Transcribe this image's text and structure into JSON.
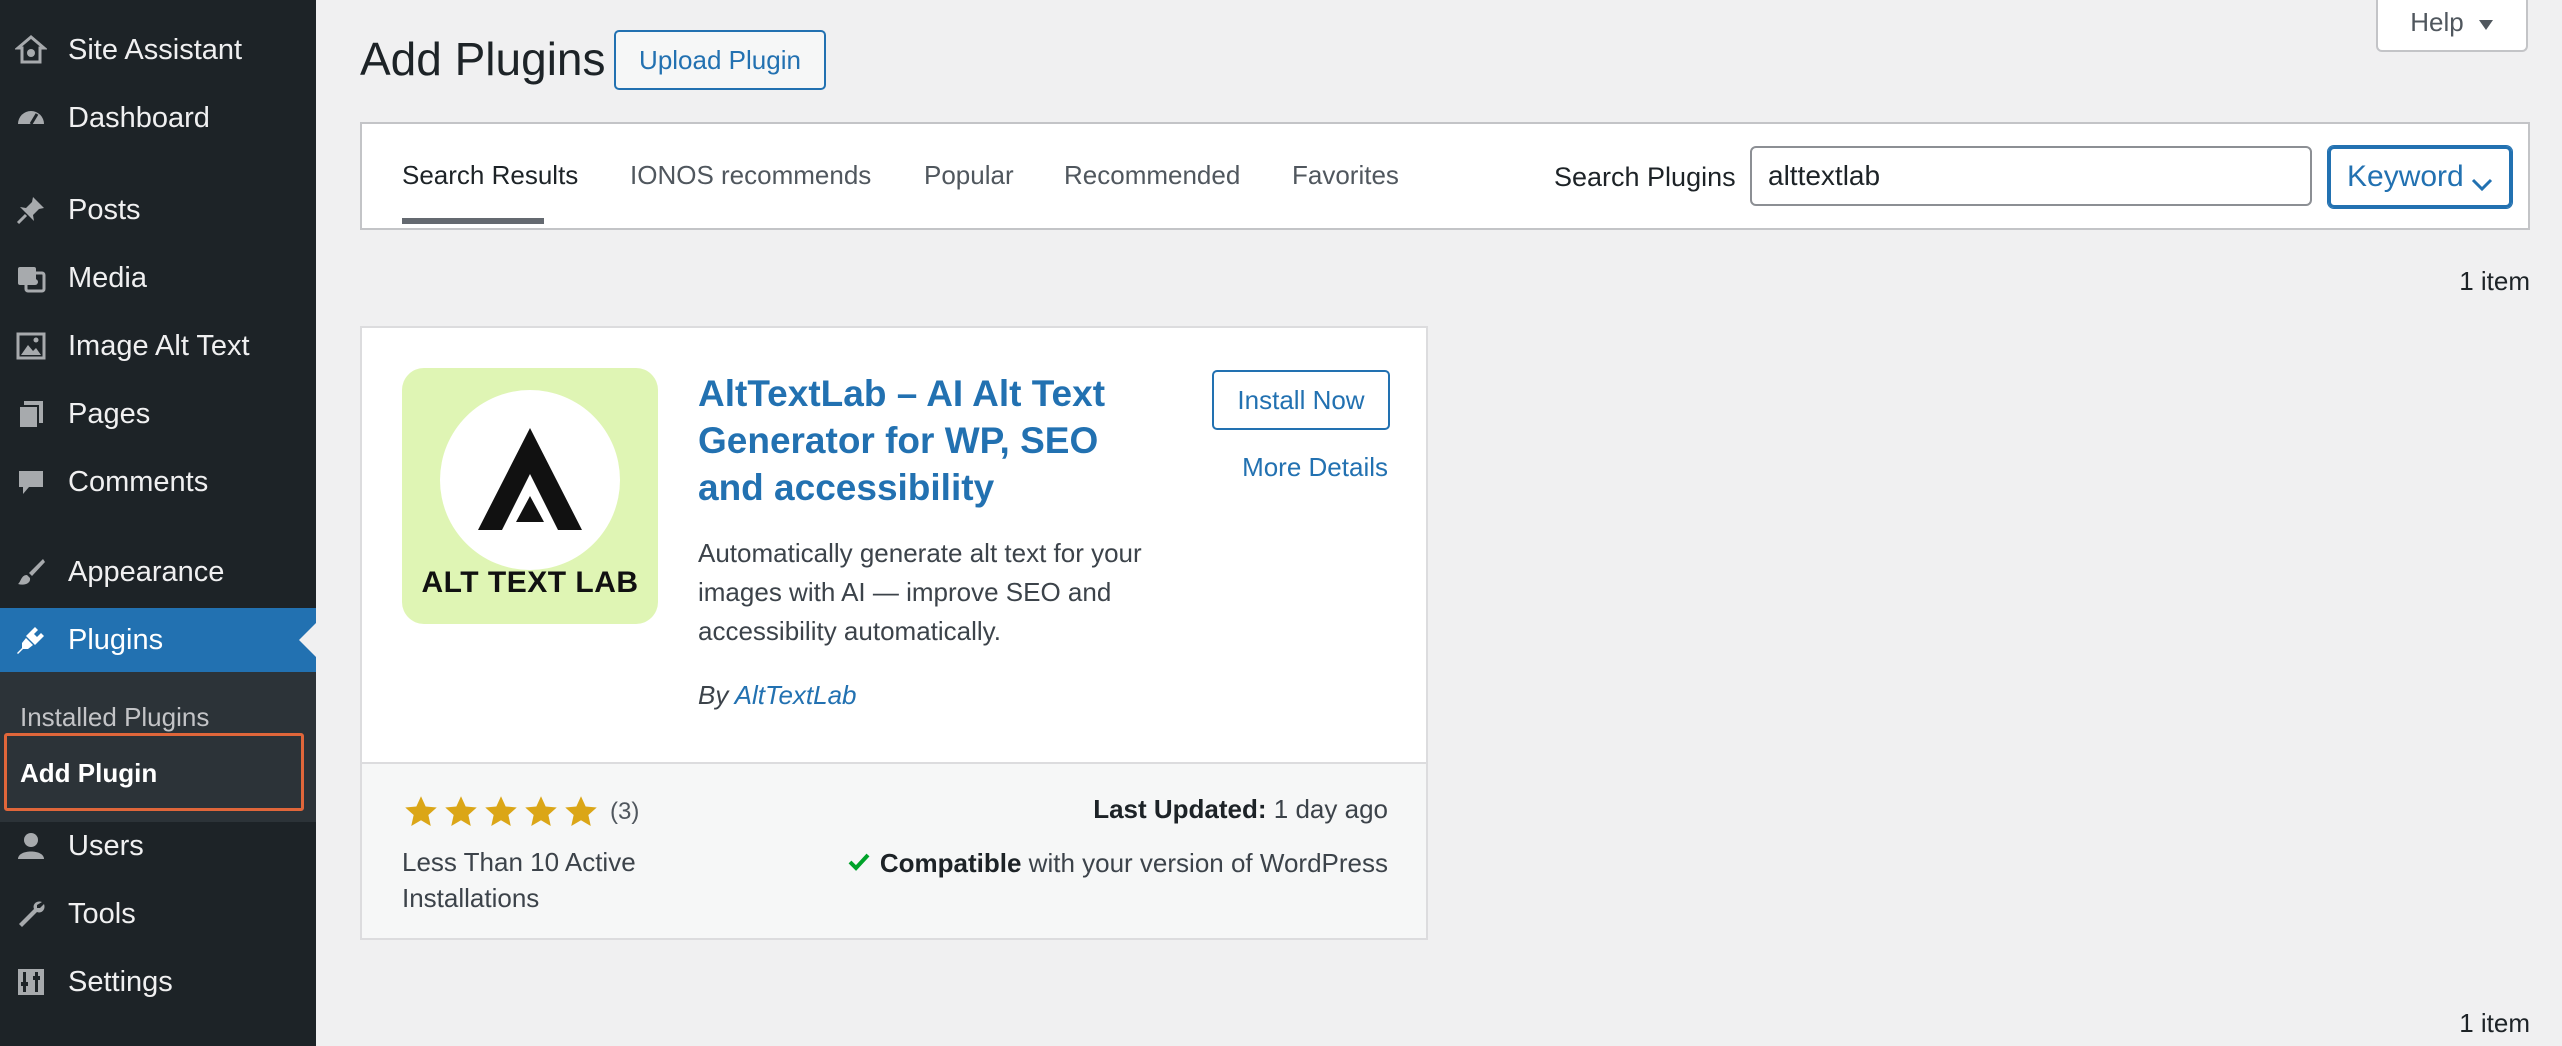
{
  "sidebar": {
    "items": [
      {
        "label": "Site Assistant",
        "icon": "home-gear-icon"
      },
      {
        "label": "Dashboard",
        "icon": "dashboard-icon"
      },
      {
        "label": "Posts",
        "icon": "pin-icon"
      },
      {
        "label": "Media",
        "icon": "media-icon"
      },
      {
        "label": "Image Alt Text",
        "icon": "image-icon"
      },
      {
        "label": "Pages",
        "icon": "pages-icon"
      },
      {
        "label": "Comments",
        "icon": "comment-icon"
      },
      {
        "label": "Appearance",
        "icon": "brush-icon"
      },
      {
        "label": "Plugins",
        "icon": "plug-icon"
      },
      {
        "label": "Users",
        "icon": "user-icon"
      },
      {
        "label": "Tools",
        "icon": "wrench-icon"
      },
      {
        "label": "Settings",
        "icon": "settings-icon"
      }
    ],
    "active": "Plugins",
    "submenu": [
      {
        "label": "Installed Plugins"
      },
      {
        "label": "Add Plugin"
      }
    ]
  },
  "header": {
    "title": "Add Plugins",
    "upload_label": "Upload Plugin",
    "help_label": "Help"
  },
  "filter": {
    "tabs": [
      {
        "label": "Search Results"
      },
      {
        "label": "IONOS recommends"
      },
      {
        "label": "Popular"
      },
      {
        "label": "Recommended"
      },
      {
        "label": "Favorites"
      }
    ],
    "search_label": "Search Plugins",
    "search_value": "alttextlab",
    "type_value": "Keyword"
  },
  "results": {
    "count_top": "1 item",
    "count_bottom": "1 item"
  },
  "plugin": {
    "icon_text": "ALT TEXT LAB",
    "name": "AltTextLab – AI Alt Text Generator for WP, SEO and accessibility",
    "description": "Automatically generate alt text for your images with AI — improve SEO and accessibility automatically.",
    "by_label": "By",
    "author": "AltTextLab",
    "install_label": "Install Now",
    "details_label": "More Details",
    "rating": 5,
    "rating_count": "(3)",
    "installs": "Less Than 10 Active Installations",
    "last_updated_label": "Last Updated:",
    "last_updated_value": "1 day ago",
    "compatible_label": "Compatible",
    "compatible_text": "with your version of WordPress"
  },
  "colors": {
    "sidebar_bg": "#1d2327",
    "accent": "#2271b1",
    "star": "#dba617",
    "check": "#00a32a",
    "highlight": "#e0663a"
  }
}
